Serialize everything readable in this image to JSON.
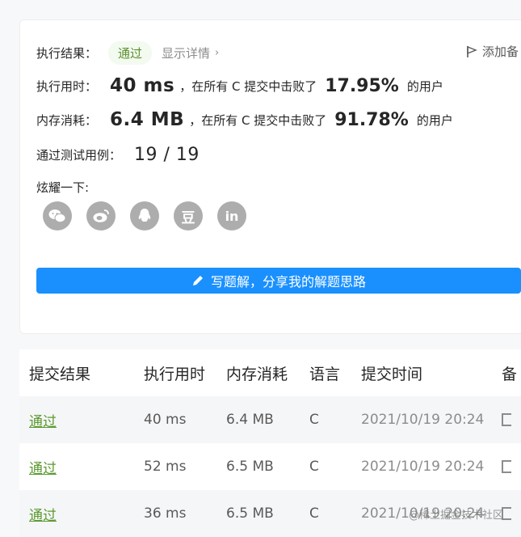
{
  "result": {
    "label": "执行结果：",
    "status": "通过",
    "detail_link": "显示详情",
    "add_note": "添加备"
  },
  "runtime": {
    "label": "执行用时：",
    "value": "40 ms",
    "middle": "，在所有 C 提交中击败了",
    "percent": "17.95%",
    "suffix": "的用户"
  },
  "memory": {
    "label": "内存消耗：",
    "value": "6.4 MB",
    "middle": "，在所有 C 提交中击败了",
    "percent": "91.78%",
    "suffix": "的用户"
  },
  "tests": {
    "label": "通过测试用例：",
    "value": "19 / 19"
  },
  "share": {
    "label": "炫耀一下:",
    "icons": [
      "wechat-icon",
      "weibo-icon",
      "qq-icon",
      "douban-icon",
      "linkedin-icon"
    ],
    "douban_glyph": "豆",
    "linkedin_glyph": "in"
  },
  "write_button": "写题解，分享我的解题思路",
  "table": {
    "headers": [
      "提交结果",
      "执行用时",
      "内存消耗",
      "语言",
      "提交时间",
      "备"
    ],
    "rows": [
      {
        "result": "通过",
        "time": "40 ms",
        "memory": "6.4 MB",
        "lang": "C",
        "submitted": "2021/10/19 20:24"
      },
      {
        "result": "通过",
        "time": "52 ms",
        "memory": "6.5 MB",
        "lang": "C",
        "submitted": "2021/10/19 20:24"
      },
      {
        "result": "通过",
        "time": "36 ms",
        "memory": "6.5 MB",
        "lang": "C",
        "submitted": "2021/10/19 20:24"
      }
    ]
  },
  "watermark": "@稀土掘金技术社区",
  "colors": {
    "primary": "#1a90ff",
    "success": "#5b9a2f",
    "share_icon_bg": "#adadad"
  }
}
